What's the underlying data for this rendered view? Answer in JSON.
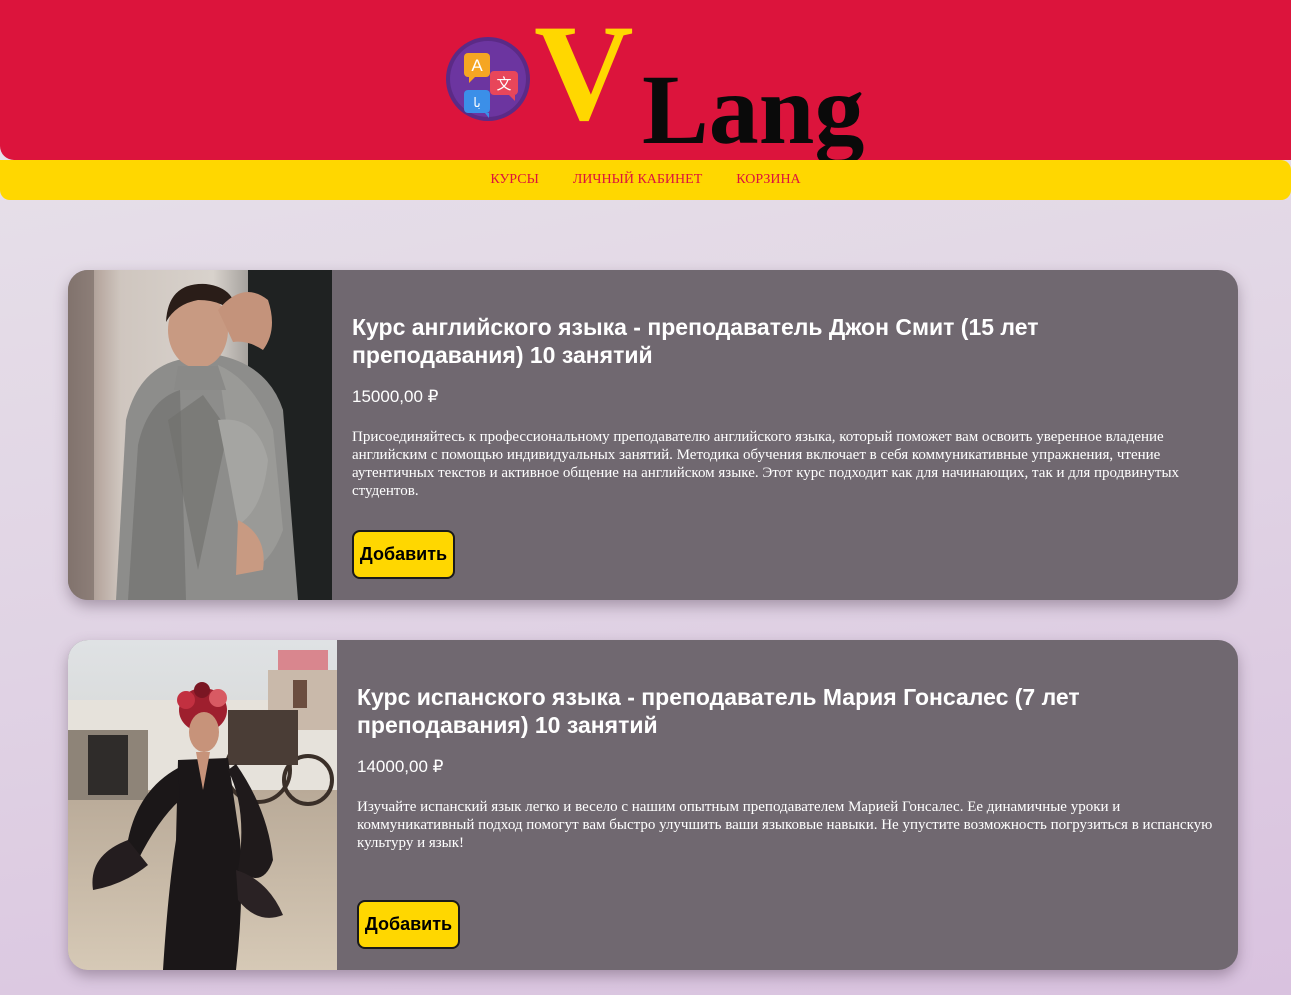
{
  "brand": {
    "letter": "V",
    "word": "Lang",
    "emblem_icon": "translate-chat-bubbles-icon",
    "emblem_glyphs": [
      "A",
      "文",
      "ﺑﺎ"
    ]
  },
  "nav": {
    "items": [
      {
        "label": "КУРСЫ"
      },
      {
        "label": "ЛИЧНЫЙ КАБИНЕТ"
      },
      {
        "label": "КОРЗИНА"
      }
    ]
  },
  "courses": [
    {
      "title": "Курс английского языка - преподаватель Джон Смит (15 лет преподавания) 10 занятий",
      "price": "15000,00 ₽",
      "description": "Присоединяйтесь к профессиональному преподавателю английского языка, который поможет вам освоить уверенное владение английским с помощью индивидуальных занятий. Методика обучения включает в себя коммуникативные упражнения, чтение аутентичных текстов и активное общение на английском языке. Этот курс подходит как для начинающих, так и для продвинутых студентов.",
      "button_label": "Добавить"
    },
    {
      "title": "Курс испанского языка - преподаватель Мария Гонсалес (7 лет преподавания) 10 занятий",
      "price": "14000,00 ₽",
      "description": "Изучайте испанский язык легко и весело с нашим опытным преподавателем Марией Гонсалес. Ее динамичные уроки и коммуникативный подход помогут вам быстро улучшить ваши языковые навыки. Не упустите возможность погрузиться в испанскую культуру и язык!",
      "button_label": "Добавить"
    }
  ],
  "colors": {
    "header": "#dc143c",
    "nav_bar": "#ffd700",
    "nav_link": "#dc143c",
    "card": "#706870",
    "button": "#ffd700"
  }
}
